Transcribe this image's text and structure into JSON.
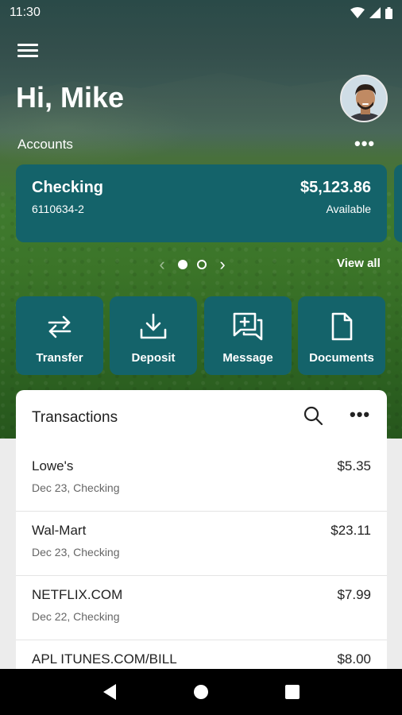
{
  "status_bar": {
    "time": "11:30"
  },
  "header": {
    "greeting": "Hi, Mike",
    "accounts_label": "Accounts"
  },
  "accounts": [
    {
      "name": "Checking",
      "number": "6110634-2",
      "balance": "$5,123.86",
      "balance_label": "Available"
    }
  ],
  "pager": {
    "view_all": "View all"
  },
  "actions": [
    {
      "label": "Transfer",
      "icon": "transfer-icon"
    },
    {
      "label": "Deposit",
      "icon": "deposit-icon"
    },
    {
      "label": "Message",
      "icon": "message-icon"
    },
    {
      "label": "Documents",
      "icon": "documents-icon"
    }
  ],
  "transactions": {
    "title": "Transactions",
    "items": [
      {
        "merchant": "Lowe's",
        "meta": "Dec 23, Checking",
        "amount": "$5.35"
      },
      {
        "merchant": "Wal-Mart",
        "meta": "Dec 23, Checking",
        "amount": "$23.11"
      },
      {
        "merchant": "NETFLIX.COM",
        "meta": "Dec 22, Checking",
        "amount": "$7.99"
      },
      {
        "merchant": "APL ITUNES.COM/BILL",
        "meta": "",
        "amount": "$8.00"
      }
    ]
  },
  "colors": {
    "accent": "#14636a",
    "card_bg": "#ffffff",
    "nav_bar": "#000000"
  }
}
